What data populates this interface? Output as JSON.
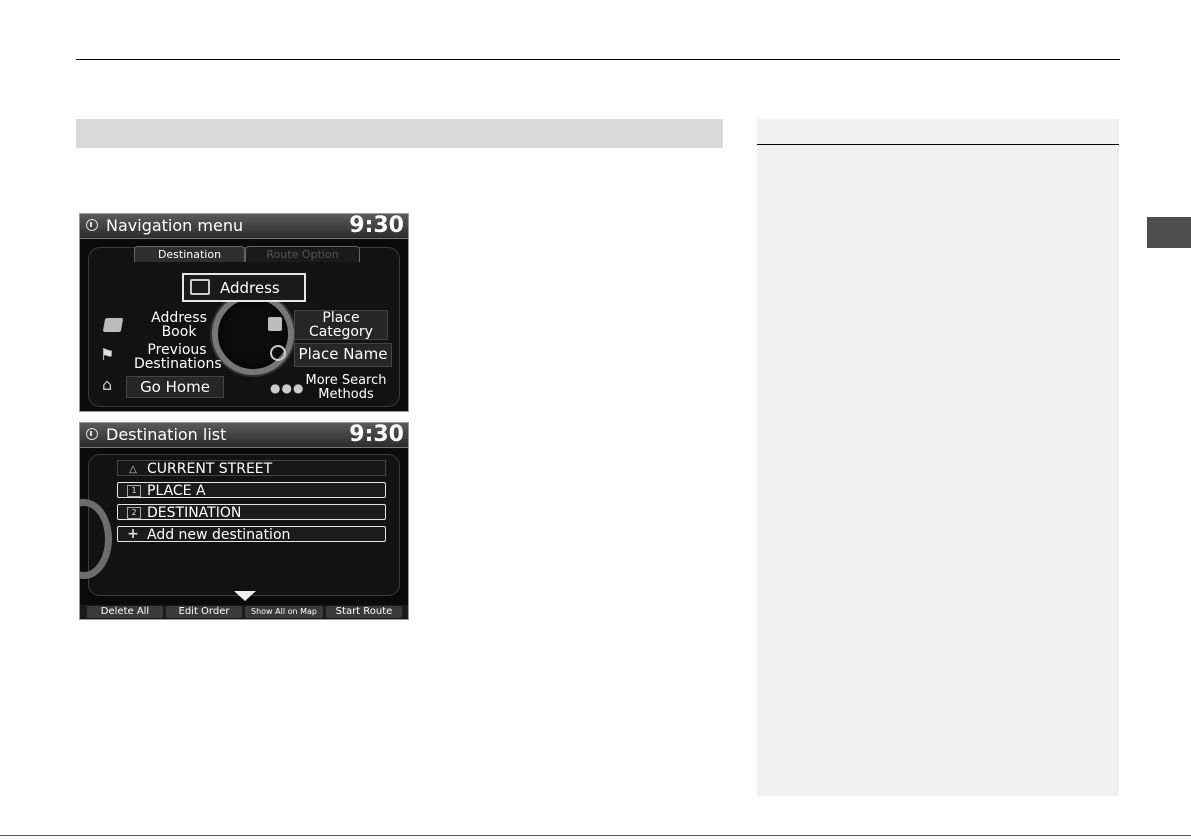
{
  "nav_screen": {
    "title": "Navigation menu",
    "time": "9:30",
    "tabs": [
      "Destination",
      "Route Option"
    ],
    "items": {
      "address": "Address",
      "address_book": [
        "Address",
        "Book"
      ],
      "place_category": [
        "Place",
        "Category"
      ],
      "previous_destinations": [
        "Previous",
        "Destinations"
      ],
      "place_name": "Place Name",
      "go_home": "Go Home",
      "more_search_methods": [
        "More Search",
        "Methods"
      ]
    }
  },
  "dest_screen": {
    "title": "Destination list",
    "time": "9:30",
    "rows": [
      {
        "icon": "current-location-icon",
        "glyph": "△",
        "label": "CURRENT STREET"
      },
      {
        "icon": "waypoint-1-icon",
        "glyph": "1",
        "label": "PLACE A"
      },
      {
        "icon": "waypoint-2-icon",
        "glyph": "2",
        "label": "DESTINATION"
      },
      {
        "icon": "plus-icon",
        "glyph": "+",
        "label": "Add new destination"
      }
    ],
    "buttons": {
      "delete_all": "Delete All",
      "edit_order": "Edit Order",
      "show_all_on_map": "Show All on Map",
      "start_route": "Start Route"
    }
  }
}
